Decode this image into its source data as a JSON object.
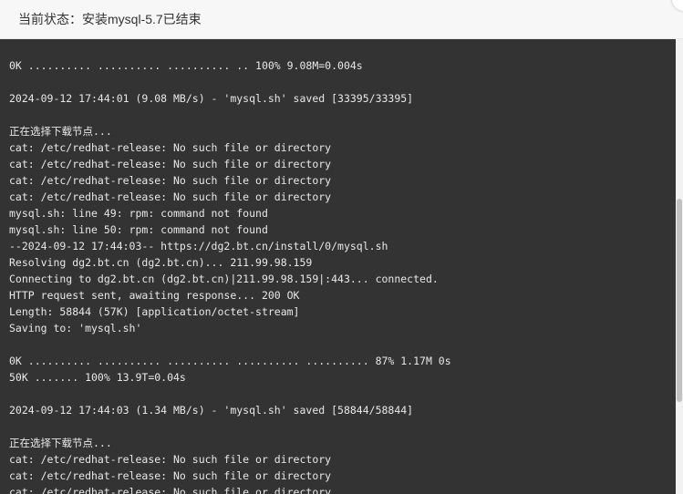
{
  "dialog": {
    "title": "当前状态：安装mysql-5.7已结束"
  },
  "terminal": {
    "lines": [
      "0K .......... .......... .......... .. 100% 9.08M=0.004s",
      "",
      "2024-09-12 17:44:01 (9.08 MB/s) - 'mysql.sh' saved [33395/33395]",
      "",
      "正在选择下载节点...",
      "cat: /etc/redhat-release: No such file or directory",
      "cat: /etc/redhat-release: No such file or directory",
      "cat: /etc/redhat-release: No such file or directory",
      "cat: /etc/redhat-release: No such file or directory",
      "mysql.sh: line 49: rpm: command not found",
      "mysql.sh: line 50: rpm: command not found",
      "--2024-09-12 17:44:03-- https://dg2.bt.cn/install/0/mysql.sh",
      "Resolving dg2.bt.cn (dg2.bt.cn)... 211.99.98.159",
      "Connecting to dg2.bt.cn (dg2.bt.cn)|211.99.98.159|:443... connected.",
      "HTTP request sent, awaiting response... 200 OK",
      "Length: 58844 (57K) [application/octet-stream]",
      "Saving to: 'mysql.sh'",
      "",
      "0K .......... .......... .......... .......... .......... 87% 1.17M 0s",
      "50K ....... 100% 13.9T=0.04s",
      "",
      "2024-09-12 17:44:03 (1.34 MB/s) - 'mysql.sh' saved [58844/58844]",
      "",
      "正在选择下载节点...",
      "cat: /etc/redhat-release: No such file or directory",
      "cat: /etc/redhat-release: No such file or directory",
      "cat: /etc/redhat-release: No such file or directory"
    ]
  }
}
